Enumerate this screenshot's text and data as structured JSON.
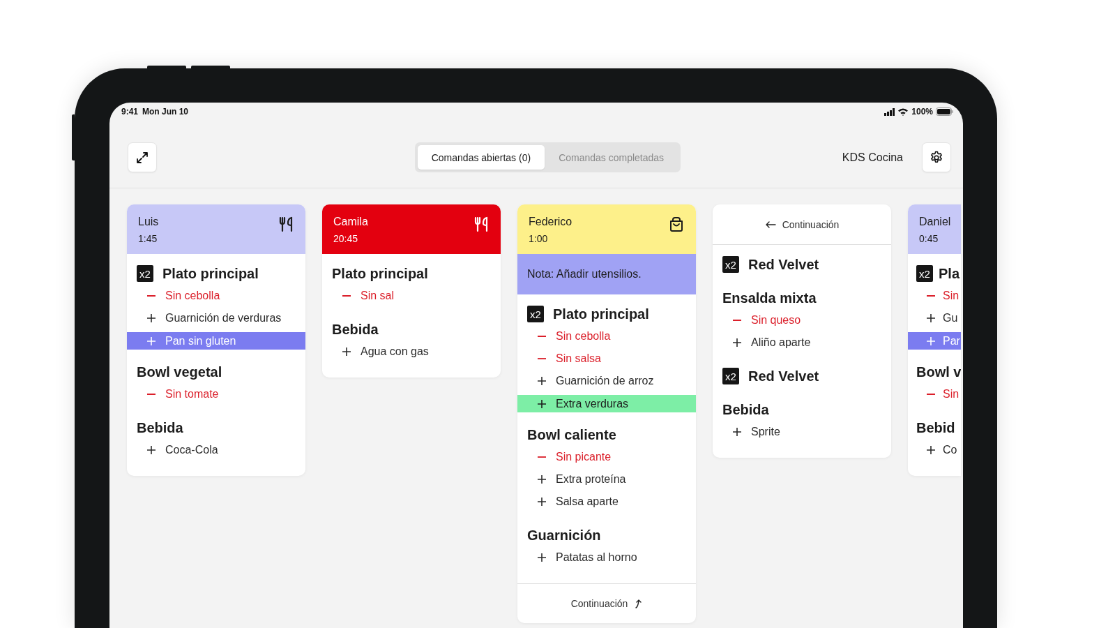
{
  "status_bar": {
    "time": "9:41",
    "date": "Mon Jun 10",
    "battery": "100%"
  },
  "toolbar": {
    "tabs": [
      {
        "label": "Comandas abiertas (0)",
        "selected": true
      },
      {
        "label": "Comandas completadas",
        "selected": false
      }
    ],
    "title": "KDS Cocina"
  },
  "cards": [
    {
      "kind": "order",
      "name": "Luis",
      "time": "1:45",
      "color": "#c7c8f7",
      "service": {
        "kind": "dine_in"
      },
      "items": [
        {
          "qty": "x2",
          "title": "Plato principal",
          "mods": [
            {
              "kind": "remove",
              "text": "Sin cebolla"
            },
            {
              "kind": "add",
              "text": "Guarnición de verduras"
            },
            {
              "kind": "add",
              "text": "Pan sin gluten",
              "color": "#7b7cf0"
            }
          ]
        },
        {
          "title": "Bowl vegetal",
          "mods": [
            {
              "kind": "remove",
              "text": "Sin tomate"
            }
          ]
        },
        {
          "title": "Bebida",
          "mods": [
            {
              "kind": "add",
              "text": "Coca-Cola"
            }
          ]
        }
      ]
    },
    {
      "kind": "order",
      "name": "Camila",
      "time": "20:45",
      "color": "#e3000f",
      "service": {
        "kind": "dine_in"
      },
      "items": [
        {
          "title": "Plato principal",
          "mods": [
            {
              "kind": "remove",
              "text": "Sin sal"
            }
          ]
        },
        {
          "title": "Bebida",
          "mods": [
            {
              "kind": "add",
              "text": "Agua con gas"
            }
          ]
        }
      ]
    },
    {
      "kind": "order",
      "name": "Federico",
      "time": "1:00",
      "color": "#fdf08a",
      "service": {
        "kind": "takeaway"
      },
      "note": "Nota: Añadir utensilios.",
      "footer": "Continuación",
      "items": [
        {
          "qty": "x2",
          "title": "Plato principal",
          "mods": [
            {
              "kind": "remove",
              "text": "Sin cebolla"
            },
            {
              "kind": "remove",
              "text": "Sin salsa"
            },
            {
              "kind": "add",
              "text": "Guarnición de arroz"
            },
            {
              "kind": "add",
              "text": "Extra verduras",
              "color": "#7deea6"
            }
          ]
        },
        {
          "title": "Bowl caliente",
          "mods": [
            {
              "kind": "remove",
              "text": "Sin picante"
            },
            {
              "kind": "add",
              "text": "Extra proteína"
            },
            {
              "kind": "add",
              "text": "Salsa aparte"
            }
          ]
        },
        {
          "title": "Guarnición",
          "mods": [
            {
              "kind": "add",
              "text": "Patatas al horno"
            }
          ]
        }
      ]
    },
    {
      "kind": "continuation",
      "label": "Continuación",
      "items": [
        {
          "qty": "x2",
          "title": "Red Velvet"
        },
        {
          "title": "Ensalda mixta",
          "mods": [
            {
              "kind": "remove",
              "text": "Sin queso"
            },
            {
              "kind": "add",
              "text": "Aliño aparte"
            }
          ]
        },
        {
          "qty": "x2",
          "title": "Red Velvet"
        },
        {
          "title": "Bebida",
          "mods": [
            {
              "kind": "add",
              "text": "Sprite"
            }
          ]
        }
      ]
    },
    {
      "kind": "order",
      "name": "Daniel",
      "time": "0:45",
      "color": "#c7c8f7",
      "items": [
        {
          "qty": "x2",
          "title": "Pla",
          "mods": [
            {
              "kind": "remove",
              "text": "Sin"
            },
            {
              "kind": "add",
              "text": "Gu"
            },
            {
              "kind": "add",
              "text": "Par",
              "color": "#7b7cf0"
            }
          ]
        },
        {
          "title": "Bowl v",
          "mods": [
            {
              "kind": "remove",
              "text": "Sin"
            }
          ]
        },
        {
          "title": "Bebid",
          "mods": [
            {
              "kind": "add",
              "text": "Co"
            }
          ]
        }
      ]
    }
  ]
}
